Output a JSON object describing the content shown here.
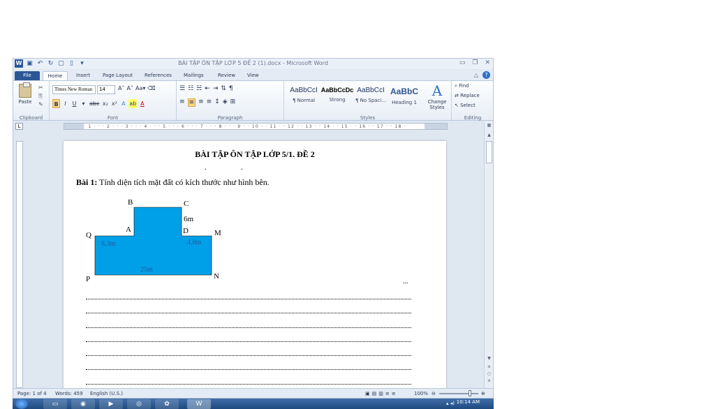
{
  "window": {
    "title": "BÀI TẬP ÔN TẬP LỚP 5 ĐỀ 2 (1).docx - Microsoft Word"
  },
  "tabs": [
    "File",
    "Home",
    "Insert",
    "Page Layout",
    "References",
    "Mailings",
    "Review",
    "View"
  ],
  "ribbon": {
    "clipboard": {
      "paste": "Paste",
      "label": "Clipboard"
    },
    "font": {
      "name": "Times New Roman",
      "size": "14",
      "label": "Font"
    },
    "paragraph": {
      "label": "Paragraph"
    },
    "styles": {
      "label": "Styles",
      "items": [
        {
          "sample": "AaBbCcI",
          "name": "¶ Normal"
        },
        {
          "sample": "AaBbCcDc",
          "name": "Strong"
        },
        {
          "sample": "AaBbCcI",
          "name": "¶ No Spaci..."
        },
        {
          "sample": "AaBbC",
          "name": "Heading 1"
        }
      ],
      "change": "Change Styles"
    },
    "editing": {
      "label": "Editing",
      "find": "Find",
      "replace": "Replace",
      "select": "Select"
    }
  },
  "document": {
    "title": "BÀI TẬP ÔN TẬP LỚP 5/1. ĐỀ 2",
    "q1_label": "Bài 1:",
    "q1_text": " Tính diện tích mặt đất có kích thước như hình bên.",
    "figure": {
      "B": "B",
      "C": "C",
      "A": "A",
      "D": "D",
      "Q": "Q",
      "M": "M",
      "P": "P",
      "N": "N",
      "cd": "6m",
      "qa": "8,3m",
      "dm": "4,8m",
      "pn": "25m"
    },
    "dots": "..."
  },
  "status": {
    "page": "Page: 1 of 4",
    "words": "Words: 459",
    "language": "English (U.S.)",
    "zoom": "100%"
  },
  "taskbar": {
    "time": "10:14 AM"
  },
  "colors": {
    "shape_fill": "#00a0e9",
    "file_tab": "#2b5797",
    "ribbon_bg": "#e8eef6"
  }
}
